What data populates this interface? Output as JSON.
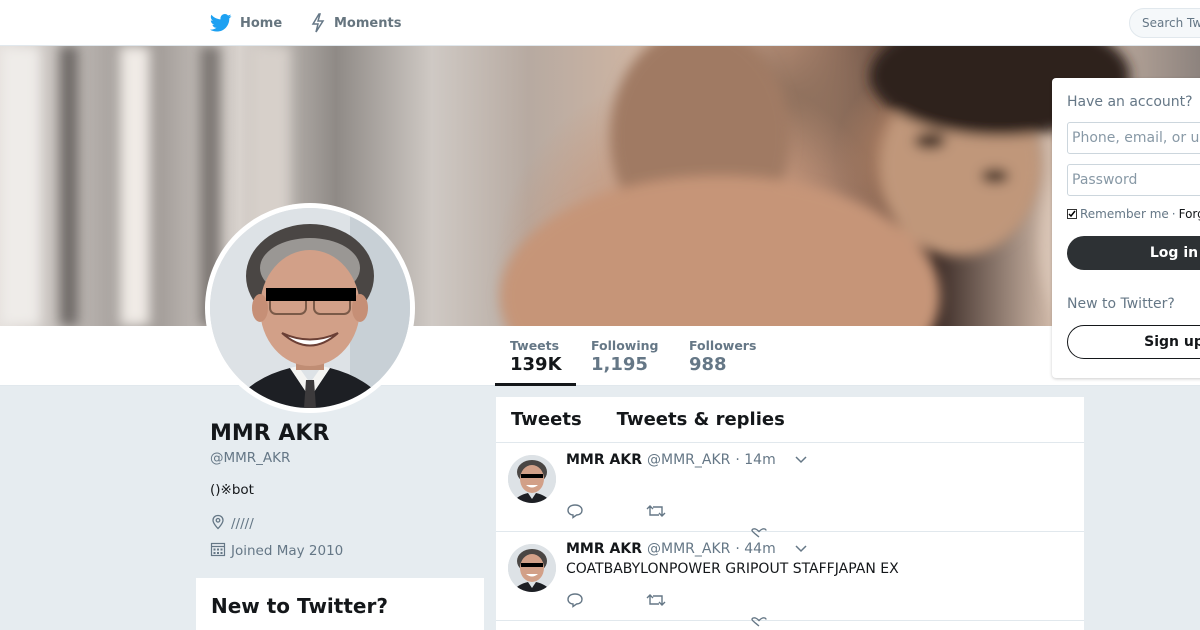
{
  "nav": {
    "home_label": "Home",
    "moments_label": "Moments",
    "search_placeholder": "Search Twitter"
  },
  "profile": {
    "name": "MMR AKR",
    "handle": "@MMR_AKR",
    "bio": "()※bot",
    "location": "/////",
    "joined": "Joined May 2010"
  },
  "stats": [
    {
      "label": "Tweets",
      "value": "139K"
    },
    {
      "label": "Following",
      "value": "1,195"
    },
    {
      "label": "Followers",
      "value": "988"
    }
  ],
  "timeline": {
    "tabs": [
      "Tweets",
      "Tweets & replies"
    ],
    "tweets": [
      {
        "name": "MMR AKR",
        "handle": "@MMR_AKR",
        "time": "· 14m",
        "text": ""
      },
      {
        "name": "MMR AKR",
        "handle": "@MMR_AKR",
        "time": "· 44m",
        "text": "COATBABYLONPOWER GRIPOUT STAFFJAPAN EX"
      }
    ]
  },
  "sidebar": {
    "signup_title": "New to Twitter?"
  },
  "login": {
    "title": "Have an account?",
    "username_placeholder": "Phone, email, or username",
    "password_placeholder": "Password",
    "remember_label": "Remember me",
    "separator": "·",
    "forgot_label": "Forgot password?",
    "login_label": "Log in",
    "new_title": "New to Twitter?",
    "signup_label": "Sign up"
  },
  "colors": {
    "brand": "#1da1f2",
    "icon_gray": "#657786",
    "dark_button": "#2d3134"
  },
  "icons": {
    "home": "twitter-bird-icon",
    "moments": "lightning-icon",
    "location": "location-pin-icon",
    "joined": "calendar-icon",
    "reply": "reply-icon",
    "retweet": "retweet-icon",
    "like": "heart-icon",
    "caret": "chevron-down-icon"
  }
}
